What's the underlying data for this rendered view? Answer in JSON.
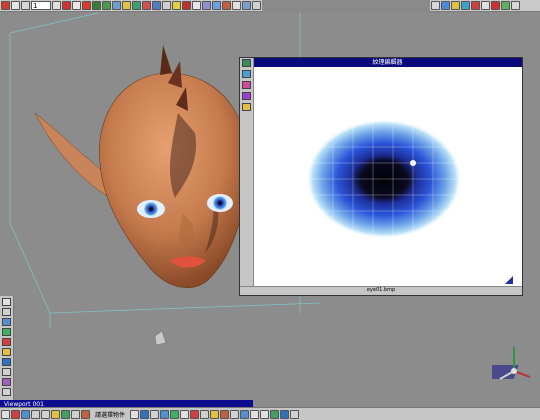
{
  "toolbar": {
    "frame_value": "1",
    "left_icons": [
      "record-icon",
      "stop-icon",
      "frame-start-icon",
      "play-icon",
      "frame-end-icon",
      "loop-icon",
      "snap-icon",
      "move-icon",
      "rotate-icon",
      "scale-icon",
      "select-icon",
      "paint-icon",
      "layer-icon",
      "sphere-icon",
      "camera-icon",
      "light-icon",
      "render-icon",
      "grid-icon",
      "zoom-icon",
      "pan-icon",
      "orbit-icon",
      "material-icon",
      "texture-icon",
      "box-icon"
    ],
    "right_icons": [
      "render-preview-icon",
      "save-icon",
      "folder-icon",
      "globe-icon",
      "paint-bucket-icon",
      "help-icon",
      "close-icon"
    ]
  },
  "texture_window": {
    "title": "紋理編輯器",
    "status": "eye01.bmp",
    "side_icons": [
      "sphere-icon",
      "cube-icon",
      "paint-icon",
      "brush-icon",
      "folder-icon"
    ]
  },
  "taskbar": {
    "item": "Viewport 001"
  },
  "bottom_bar": {
    "status": "請選擇物件"
  },
  "colors": {
    "viewport_bg": "#8c8c8c",
    "title_bar": "#0a0a7c",
    "wire_box": "#7fcfcf",
    "skin": "#c57b4d",
    "iris": "#2a55d8"
  }
}
